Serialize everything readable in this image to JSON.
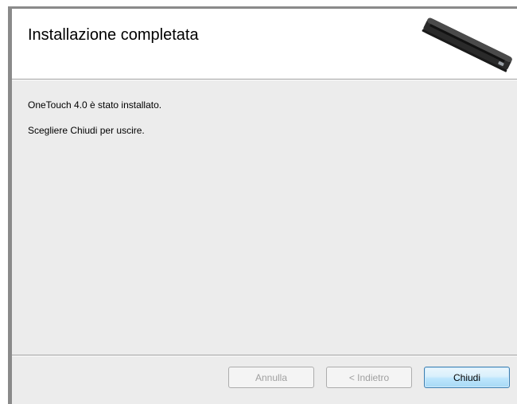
{
  "header": {
    "title": "Installazione completata"
  },
  "body": {
    "line1": "OneTouch 4.0 è stato installato.",
    "line2": "Scegliere Chiudi per uscire."
  },
  "buttons": {
    "cancel_label": "Annulla",
    "back_label": "< Indietro",
    "close_label": "Chiudi"
  },
  "icons": {
    "header_image": "scanner-icon"
  }
}
